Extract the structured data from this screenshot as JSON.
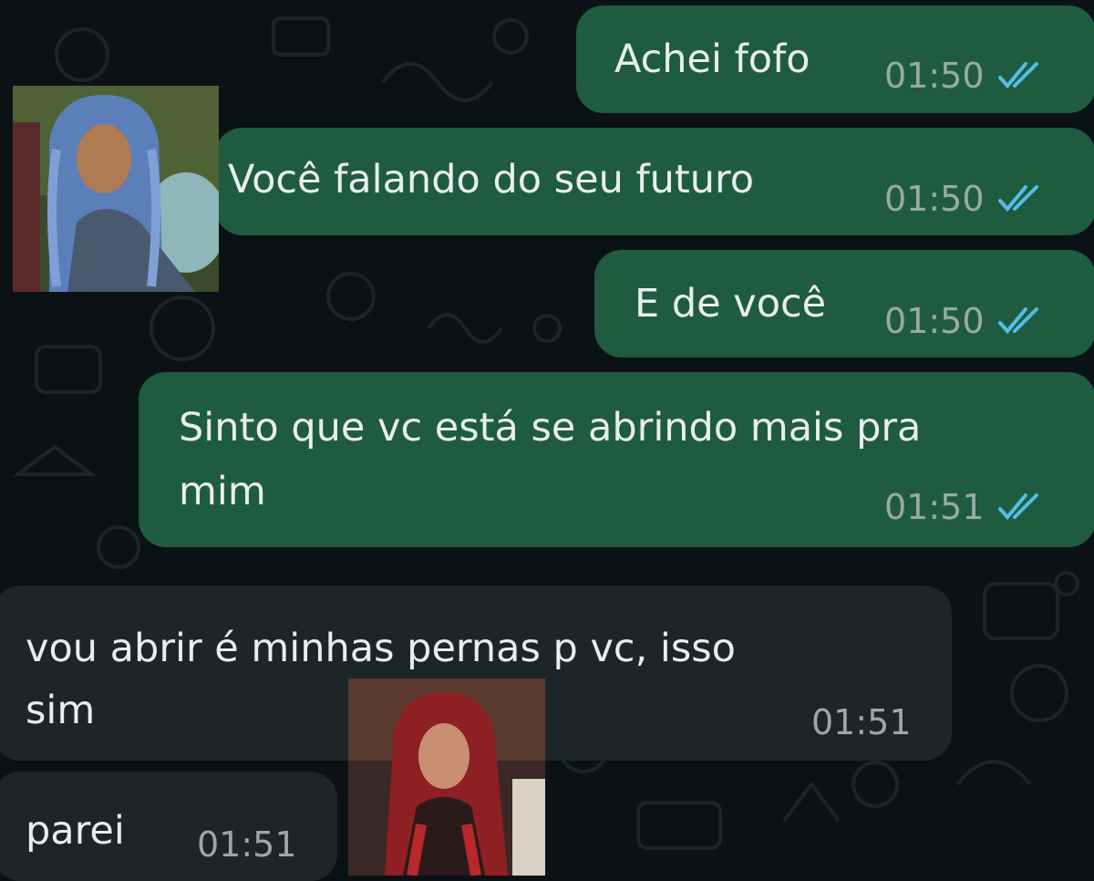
{
  "colors": {
    "background": "#0b1216",
    "outgoing_bubble": "#1f5c3f",
    "incoming_bubble": "#1c2528",
    "text": "#e9edef",
    "timestamp": "#9aa9a8",
    "read_ticks": "#53bdeb"
  },
  "messages": [
    {
      "direction": "outgoing",
      "text": "Achei fofo",
      "time": "01:50",
      "status": "read"
    },
    {
      "direction": "outgoing",
      "text": "Você falando do seu futuro",
      "time": "01:50",
      "status": "read"
    },
    {
      "direction": "outgoing",
      "text": "E de você",
      "time": "01:50",
      "status": "read"
    },
    {
      "direction": "outgoing",
      "text_line1": "Sinto que vc está se abrindo mais pra",
      "text_line2": "mim",
      "time": "01:51",
      "status": "read"
    },
    {
      "direction": "incoming",
      "text_line1": "vou abrir é minhas pernas p vc, isso",
      "text_line2": "sim",
      "time": "01:51"
    },
    {
      "direction": "incoming",
      "text": "parei",
      "time": "01:51"
    }
  ],
  "icons": {
    "read_status": "double-check-icon"
  },
  "overlays": [
    {
      "subject": "character-blue-curly-hair"
    },
    {
      "subject": "character-red-hair"
    }
  ]
}
